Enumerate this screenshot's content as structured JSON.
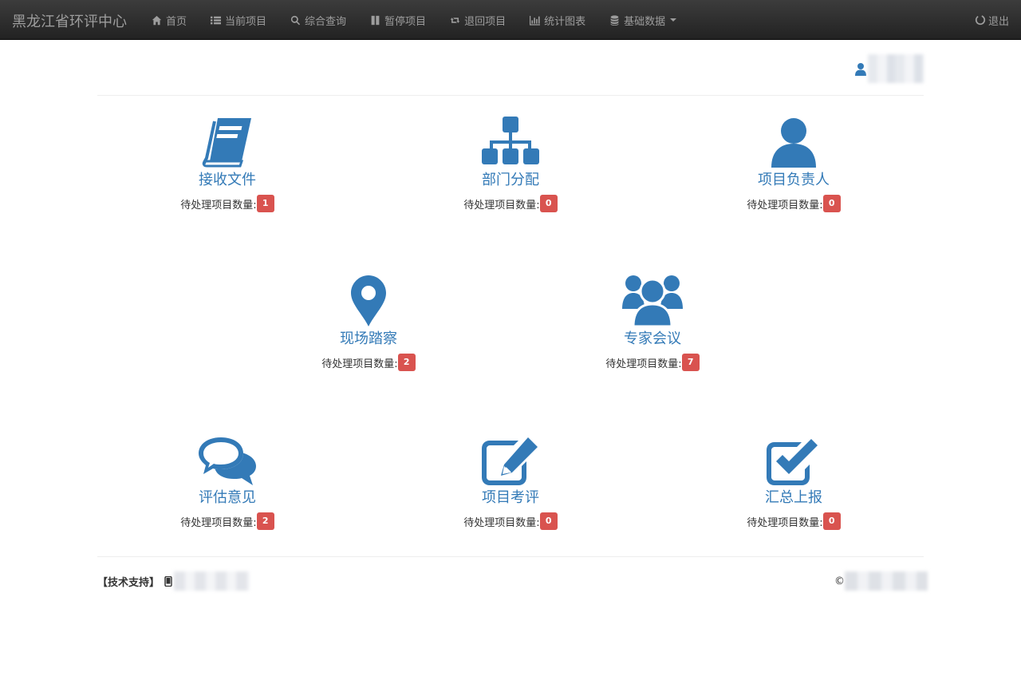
{
  "navbar": {
    "brand": "黑龙江省环评中心",
    "items": [
      {
        "label": "首页",
        "icon": "home-icon"
      },
      {
        "label": "当前项目",
        "icon": "list-icon"
      },
      {
        "label": "综合查询",
        "icon": "search-icon"
      },
      {
        "label": "暂停项目",
        "icon": "pause-icon"
      },
      {
        "label": "退回项目",
        "icon": "retweet-icon"
      },
      {
        "label": "统计图表",
        "icon": "stats-icon"
      },
      {
        "label": "基础数据",
        "icon": "database-icon",
        "dropdown": true
      }
    ],
    "logout": {
      "label": "退出",
      "icon": "power-icon"
    }
  },
  "user": {
    "icon": "user-icon"
  },
  "accent_color": "#337ab7",
  "badge_color": "#d9534f",
  "cards": [
    {
      "title": "接收文件",
      "count_label": "待处理项目数量:",
      "count": "1",
      "icon": "book-icon"
    },
    {
      "title": "部门分配",
      "count_label": "待处理项目数量:",
      "count": "0",
      "icon": "sitemap-icon"
    },
    {
      "title": "项目负责人",
      "count_label": "待处理项目数量:",
      "count": "0",
      "icon": "person-icon"
    },
    {
      "title": "现场踏察",
      "count_label": "待处理项目数量:",
      "count": "2",
      "icon": "map-marker-icon"
    },
    {
      "title": "专家会议",
      "count_label": "待处理项目数量:",
      "count": "7",
      "icon": "group-icon"
    },
    {
      "title": "评估意见",
      "count_label": "待处理项目数量:",
      "count": "2",
      "icon": "comments-icon"
    },
    {
      "title": "项目考评",
      "count_label": "待处理项目数量:",
      "count": "0",
      "icon": "edit-icon"
    },
    {
      "title": "汇总上报",
      "count_label": "待处理项目数量:",
      "count": "0",
      "icon": "check-square-icon"
    }
  ],
  "footer": {
    "support_label": "【技术支持】",
    "phone_icon": "mobile-icon",
    "copyright_symbol": "©"
  }
}
